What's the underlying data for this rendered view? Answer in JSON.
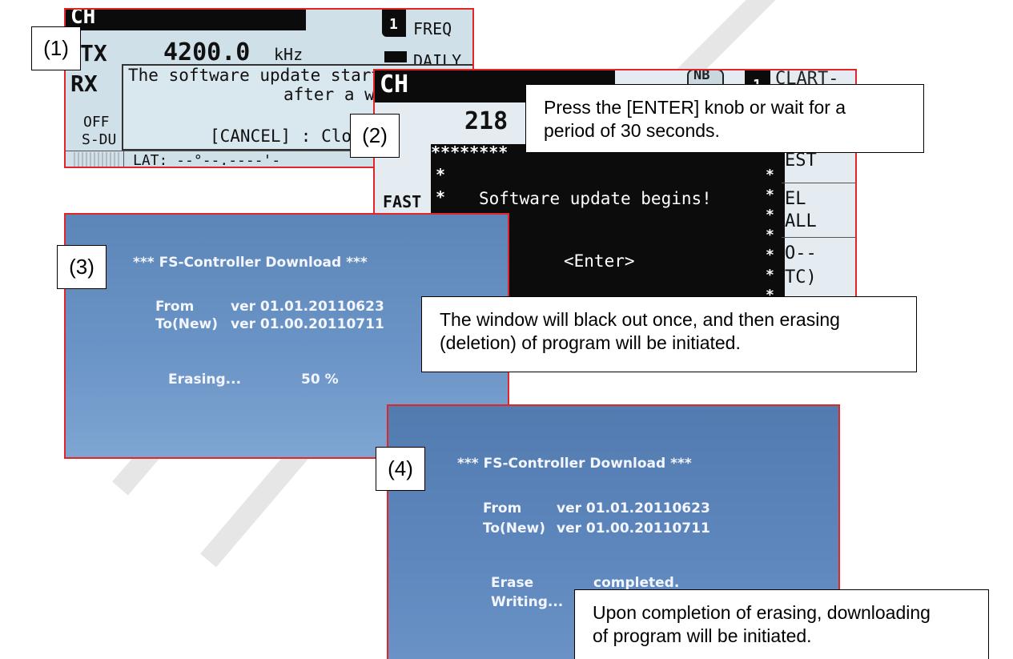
{
  "labels": {
    "step1": "(1)",
    "step2": "(2)",
    "step3": "(3)",
    "step4": "(4)"
  },
  "callouts": {
    "c2_line1": "Press the [ENTER] knob or wait for a",
    "c2_line2": "period of 30 seconds.",
    "c3_line1": "The window will black out once, and then erasing",
    "c3_line2": "(deletion) of program will be initiated.",
    "c4_line1": "Upon completion of erasing, downloading",
    "c4_line2": "of program will be initiated."
  },
  "screen1": {
    "ch": "CH",
    "tx": "TX",
    "freq_value": "4200.0",
    "freq_unit": "kHz",
    "rx": "RX",
    "dialog_line1": "The software update start",
    "dialog_line2": "after a w",
    "off": "OFF",
    "sdu": "S-DU",
    "cancel_text": "[CANCEL] : Close w",
    "lat": "LAT: --°--.----'-",
    "side_num": "1",
    "side_freq": "FREQ",
    "side_daily": "DAILY"
  },
  "screen2": {
    "ch": "CH",
    "nb": "NB",
    "side_num": "1",
    "clart": "CLART-",
    "freq_partial": "218",
    "stars": "********",
    "fast": "FAST",
    "message": "Software update begins!",
    "enter": "<Enter>",
    "side_est": "EST",
    "side_el": "EL",
    "side_all": "ALL",
    "side_o": "O--",
    "side_tc": "TC)"
  },
  "screen3": {
    "title": "*** FS-Controller Download ***",
    "from_label": "From",
    "from_ver": "ver 01.01.20110623",
    "to_label": "To(New)",
    "to_ver": "ver 01.00.20110711",
    "erasing_label": "Erasing...",
    "erasing_pct": "50 %"
  },
  "screen4": {
    "title": "*** FS-Controller Download ***",
    "from_label": "From",
    "from_ver": "ver 01.01.20110623",
    "to_label": "To(New)",
    "to_ver": "ver 01.00.20110711",
    "erase_label": "Erase",
    "erase_status": "completed.",
    "writing_label": "Writing..."
  },
  "colors": {
    "frame": "#e0262b",
    "lcd_light": "#cfe0e9",
    "lcd_dark": "#0c0c0c",
    "download_blue": "#5f88bd"
  }
}
